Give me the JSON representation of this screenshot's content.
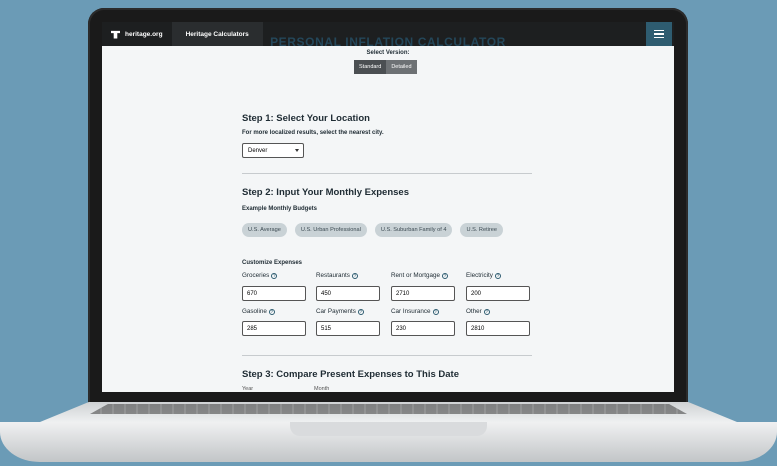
{
  "topbar": {
    "brand": "heritage.org",
    "tab": "Heritage Calculators"
  },
  "page": {
    "title": "PERSONAL INFLATION CALCULATOR",
    "version_label": "Select Version:",
    "versions": [
      "Standard",
      "Detailed"
    ]
  },
  "step1": {
    "heading": "Step 1: Select Your Location",
    "note": "For more localized results, select the nearest city.",
    "city": "Denver"
  },
  "step2": {
    "heading": "Step 2: Input Your Monthly Expenses",
    "budgets_label": "Example Monthly Budgets",
    "budgets": [
      "U.S. Average",
      "U.S. Urban Professional",
      "U.S. Suburban Family of 4",
      "U.S. Retiree"
    ],
    "customize_label": "Customize Expenses",
    "fields": [
      {
        "label": "Groceries",
        "value": "670"
      },
      {
        "label": "Restaurants",
        "value": "450"
      },
      {
        "label": "Rent or Mortgage",
        "value": "2710"
      },
      {
        "label": "Electricity",
        "value": "200"
      },
      {
        "label": "Gasoline",
        "value": "285"
      },
      {
        "label": "Car Payments",
        "value": "515"
      },
      {
        "label": "Car Insurance",
        "value": "230"
      },
      {
        "label": "Other",
        "value": "2810"
      }
    ],
    "help_glyph": "?"
  },
  "step3": {
    "heading": "Step 3: Compare Present Expenses to This Date",
    "year_label": "Year",
    "month_label": "Month"
  },
  "colors": {
    "accent": "#2e5c70",
    "background": "#6b9bb6"
  }
}
